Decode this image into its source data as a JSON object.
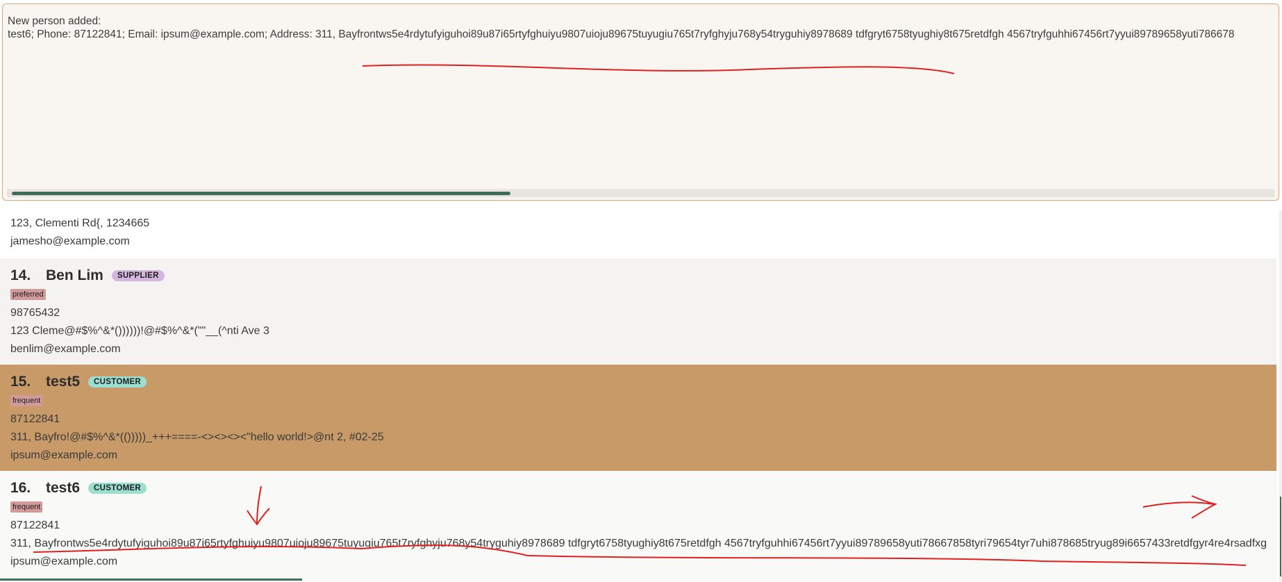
{
  "result_display": {
    "title_line": "New person added:",
    "detail_line": "test6; Phone: 87122841; Email: ipsum@example.com; Address: 311, Bayfrontws5e4rdytufyiguhoi89u87i65rtyfghuiyu9807uioju89675tuyugiu765t7ryfghyju768y54tryguhiy8978689 tdfgryt6758tyughiy8t675retdfgh 4567tryfguhhi67456rt7yyui89789658yuti786678"
  },
  "person_list": {
    "partial_card": {
      "address": "123, Clementi Rd{, 1234665",
      "email": "jamesho@example.com"
    },
    "cards": [
      {
        "index": "14.",
        "name": "Ben Lim",
        "role": "SUPPLIER",
        "tag": "preferred",
        "phone": "98765432",
        "address": "123 Cleme@#$%^&*())))))!@#$%^&*(\"\"__(^nti Ave 3",
        "email": "benlim@example.com"
      },
      {
        "index": "15.",
        "name": "test5",
        "role": "CUSTOMER",
        "tag": "frequent",
        "phone": "87122841",
        "address": "311, Bayfro!@#$%^&*(()))))_+++====-<><><><\"hello world!>@nt 2, #02-25",
        "email": "ipsum@example.com",
        "selected": true
      },
      {
        "index": "16.",
        "name": "test6",
        "role": "CUSTOMER",
        "tag": "frequent",
        "phone": "87122841",
        "address": "311, Bayfrontws5e4rdytufyiguhoi89u87i65rtyfghuiyu9807uioju89675tuyugiu765t7ryfghyju768y54tryguhiy8978689 tdfgryt6758tyughiy8t675retdfgh 4567tryfguhhi67456rt7yyui89789658yuti78667858tyri79654tyr7uhi878685tryug89i6657433retdfgyr4re4rsadfxgr",
        "email": "ipsum@example.com"
      }
    ]
  },
  "colors": {
    "selected_card": "#c89a68",
    "accent_scroll": "#3f6e56",
    "annotation": "#e02020"
  }
}
